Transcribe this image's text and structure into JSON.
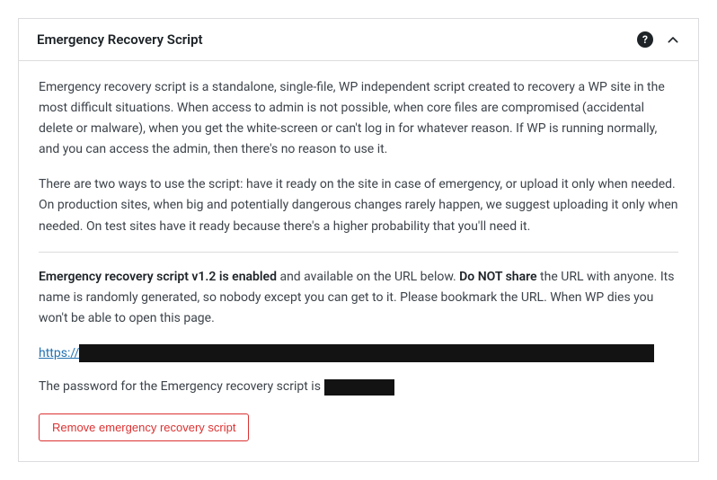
{
  "panel": {
    "title": "Emergency Recovery Script",
    "paragraph1": "Emergency recovery script is a standalone, single-file, WP independent script created to recovery a WP site in the most difficult situations. When access to admin is not possible, when core files are compromised (accidental delete or malware), when you get the white-screen or can't log in for whatever reason. If WP is running normally, and you can access the admin, then there's no reason to use it.",
    "paragraph2": "There are two ways to use the script: have it ready on the site in case of emergency, or upload it only when needed. On production sites, when big and potentially dangerous changes rarely happen, we suggest uploading it only when needed. On test sites have it ready because there's a higher probability that you'll need it.",
    "status_bold1": "Emergency recovery script v1.2 is enabled",
    "status_mid": " and available on the URL below. ",
    "status_bold2": "Do NOT share",
    "status_tail": " the URL with anyone. Its name is randomly generated, so nobody except you can get to it. Please bookmark the URL. When WP dies you won't be able to open this page.",
    "url_prefix": "https://",
    "password_label": "The password for the Emergency recovery script is ",
    "remove_button": "Remove emergency recovery script",
    "help_glyph": "?"
  }
}
